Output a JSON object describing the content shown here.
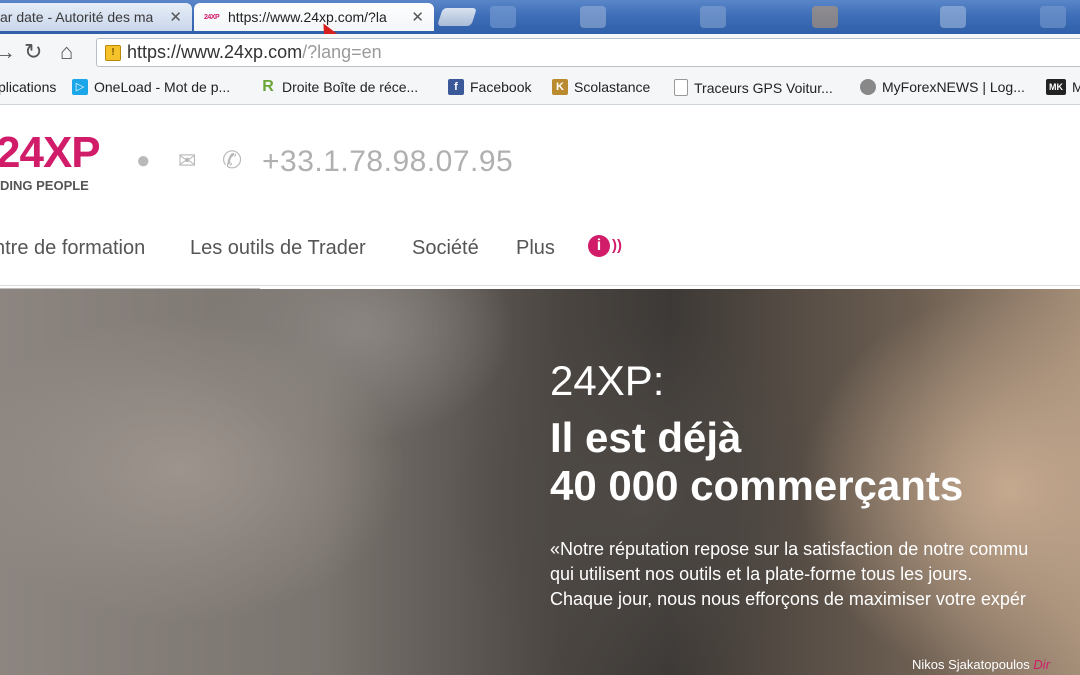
{
  "browser": {
    "tabs": [
      {
        "title": "ar date - Autorité des ma",
        "close": "✕",
        "active": false
      },
      {
        "title": "https://www.24xp.com/?la",
        "close": "✕",
        "active": true
      }
    ],
    "tab_favicon_text": "24XP",
    "address_bar": {
      "host": "https://www.24xp.com",
      "rest": "/?lang=en"
    },
    "bookmarks": [
      {
        "label": "plications",
        "icon": "apps-grid-icon",
        "color": "#5b8def"
      },
      {
        "label": "OneLoad - Mot de p...",
        "icon": "oneload-icon",
        "color": "#1aa6e8"
      },
      {
        "label": "Droite Boîte de réce...",
        "icon": "r-logo-icon",
        "color": "#6ba539"
      },
      {
        "label": "Facebook",
        "icon": "facebook-icon",
        "color": "#3b5998"
      },
      {
        "label": "Scolastance",
        "icon": "scolastance-icon",
        "color": "#b98a2e"
      },
      {
        "label": "Traceurs GPS Voitur...",
        "icon": "page-icon",
        "color": "#ffffff"
      },
      {
        "label": "MyForexNEWS | Log...",
        "icon": "globe-icon",
        "color": "#888888"
      },
      {
        "label": "M",
        "icon": "mk-icon",
        "color": "#222222"
      }
    ]
  },
  "site": {
    "brand_color": "#d11c6a",
    "logo": {
      "main": "24XP",
      "tagline": "DING PEOPLE"
    },
    "phone": "+33.1.78.98.07.95",
    "nav": [
      "ntre de formation",
      "Les outils de Trader",
      "Société",
      "Plus"
    ],
    "info_icon": "i"
  },
  "hero": {
    "kicker": "24XP:",
    "headline_1": "Il est déjà",
    "headline_2": "40 000 commerçants",
    "quote_lines": [
      "«Notre réputation repose sur la satisfaction de notre commu",
      "qui utilisent nos outils et la plate-forme tous les jours.",
      "Chaque jour, nous nous efforçons de maximiser votre expér"
    ],
    "author": "Nikos Sjakatopoulos",
    "author_role": "Dir"
  }
}
